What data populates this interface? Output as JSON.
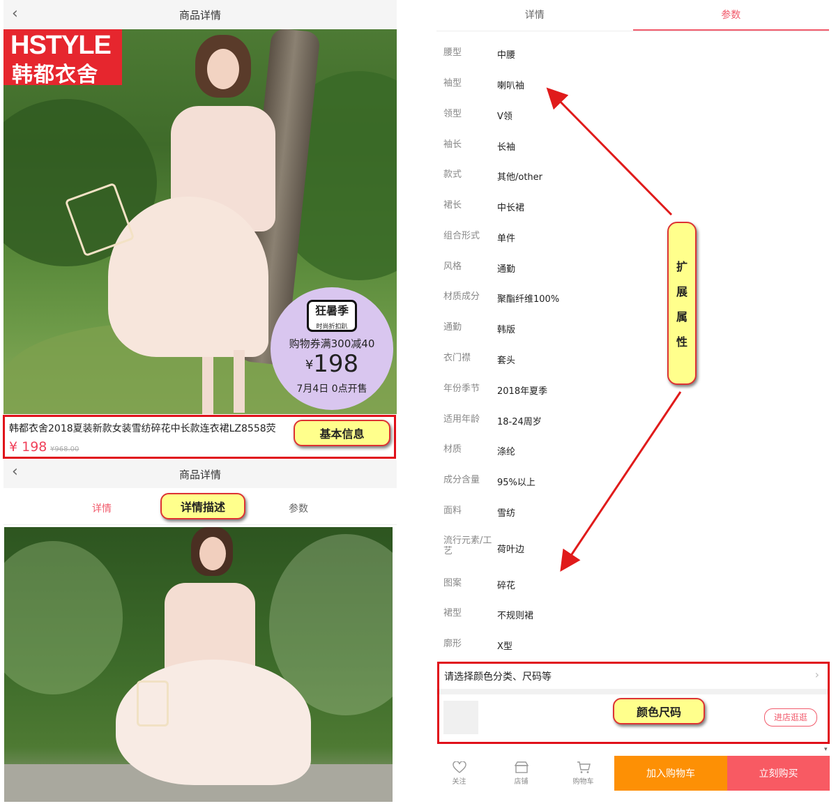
{
  "top_header": {
    "title": "商品详情"
  },
  "banner": {
    "brand_en": "HSTYLE",
    "brand_cn": "韩都衣舍",
    "promo_badge": "狂暑季",
    "promo_badge_sub": "时尚折扣趴",
    "promo_coupon": "购物券满300减40",
    "promo_currency": "¥",
    "promo_price": "198",
    "promo_date": "7月4日 0点开售"
  },
  "product": {
    "title": "韩都衣舍2018夏装新款女装雪纺碎花中长款连衣裙LZ8558荧",
    "price": "¥ 198",
    "old_price": "¥968.00"
  },
  "detail_header": {
    "title": "商品详情"
  },
  "tabs": [
    {
      "label": "详情"
    },
    {
      "label": "参数"
    }
  ],
  "params": [
    {
      "k": "腰型",
      "v": "中腰"
    },
    {
      "k": "袖型",
      "v": "喇叭袖"
    },
    {
      "k": "领型",
      "v": "V领"
    },
    {
      "k": "袖长",
      "v": "长袖"
    },
    {
      "k": "款式",
      "v": "其他/other"
    },
    {
      "k": "裙长",
      "v": "中长裙"
    },
    {
      "k": "组合形式",
      "v": "单件"
    },
    {
      "k": "风格",
      "v": "通勤"
    },
    {
      "k": "材质成分",
      "v": "聚酯纤维100%"
    },
    {
      "k": "通勤",
      "v": "韩版"
    },
    {
      "k": "衣门襟",
      "v": "套头"
    },
    {
      "k": "年份季节",
      "v": "2018年夏季"
    },
    {
      "k": "适用年龄",
      "v": "18-24周岁"
    },
    {
      "k": "材质",
      "v": "涤纶"
    },
    {
      "k": "成分含量",
      "v": "95%以上"
    },
    {
      "k": "面料",
      "v": "雪纺"
    },
    {
      "k": "流行元素/工艺",
      "v": "荷叶边"
    },
    {
      "k": "图案",
      "v": "碎花"
    },
    {
      "k": "裙型",
      "v": "不规则裙"
    },
    {
      "k": "廓形",
      "v": "X型"
    }
  ],
  "sku": {
    "select_text": "请选择颜色分类、尺码等",
    "shop_button": "进店逛逛"
  },
  "bottom_bar": {
    "follow": "关注",
    "shop": "店铺",
    "cart": "购物车",
    "add_cart": "加入购物车",
    "buy_now": "立刻购买"
  },
  "annotations": {
    "basic_info": "基本信息",
    "detail_desc": "详情描述",
    "ext_attr": [
      "扩",
      "展",
      "属",
      "性"
    ],
    "color_size": "颜色尺码"
  },
  "colors": {
    "accent_red": "#f15a6b",
    "annotation_border": "#e0101a",
    "cart_orange": "#fd9005",
    "buy_red": "#f85a63",
    "callout_yellow": "#ffff8c"
  }
}
